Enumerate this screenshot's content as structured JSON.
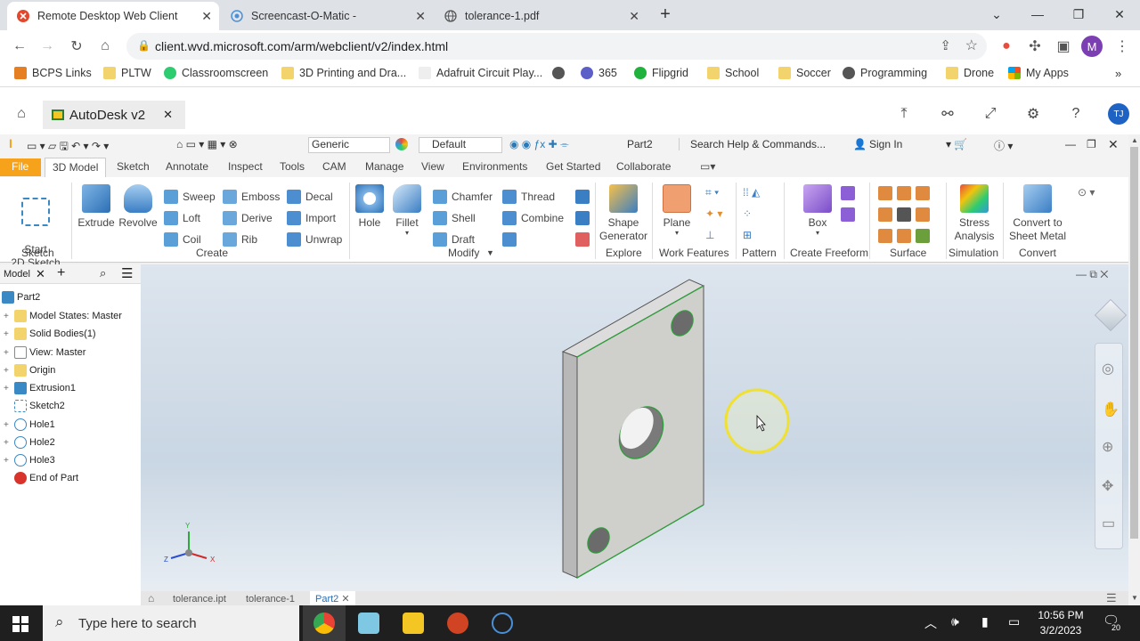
{
  "browser": {
    "tabs": [
      {
        "title": "Remote Desktop Web Client",
        "active": true
      },
      {
        "title": "Screencast-O-Matic -",
        "active": false
      },
      {
        "title": "tolerance-1.pdf",
        "active": false
      }
    ],
    "new_tab": "+",
    "url": "client.wvd.microsoft.com/arm/webclient/v2/index.html",
    "profile_initial": "M",
    "bookmarks": [
      "BCPS Links",
      "PLTW",
      "Classroomscreen",
      "3D Printing and Dra...",
      "Adafruit Circuit Play...",
      "365",
      "Flipgrid",
      "School",
      "Soccer",
      "Programming",
      "Drone",
      "My Apps"
    ]
  },
  "wvd": {
    "tab_title": "AutoDesk v2",
    "user_initials": "TJ"
  },
  "inventor": {
    "appearance": "Generic",
    "material": "Default",
    "doc_name": "Part2",
    "search_placeholder": "Search Help & Commands...",
    "sign_in": "Sign In",
    "tabs": [
      "File",
      "3D Model",
      "Sketch",
      "Annotate",
      "Inspect",
      "Tools",
      "CAM",
      "Manage",
      "View",
      "Environments",
      "Get Started",
      "Collaborate"
    ],
    "ribbon": {
      "start_sketch": "Start\n2D Sketch",
      "extrude": "Extrude",
      "revolve": "Revolve",
      "sweep": "Sweep",
      "loft": "Loft",
      "coil": "Coil",
      "emboss": "Emboss",
      "derive": "Derive",
      "rib": "Rib",
      "decal": "Decal",
      "import": "Import",
      "unwrap": "Unwrap",
      "hole": "Hole",
      "fillet": "Fillet",
      "chamfer": "Chamfer",
      "shell": "Shell",
      "draft": "Draft",
      "thread": "Thread",
      "combine": "Combine",
      "shape_generator": "Shape\nGenerator",
      "plane": "Plane",
      "box": "Box",
      "stress": "Stress\nAnalysis",
      "convert": "Convert to\nSheet Metal",
      "groups": [
        "Sketch",
        "Create",
        "Modify",
        "Explore",
        "Work Features",
        "Pattern",
        "Create Freeform",
        "Surface",
        "Simulation",
        "Convert"
      ]
    },
    "browser_title": "Model",
    "tree": [
      "Part2",
      "Model States: Master",
      "Solid Bodies(1)",
      "View: Master",
      "Origin",
      "Extrusion1",
      "Sketch2",
      "Hole1",
      "Hole2",
      "Hole3",
      "End of Part"
    ],
    "doc_tabs": [
      "tolerance.ipt",
      "tolerance-1",
      "Part2"
    ]
  },
  "taskbar": {
    "search_placeholder": "Type here to search",
    "time": "10:56 PM",
    "date": "3/2/2023",
    "notifications": "20"
  },
  "colors": {
    "file_tab": "#f6a31b",
    "viewport": "#d3dde8",
    "taskbar": "#1f1f1f"
  }
}
